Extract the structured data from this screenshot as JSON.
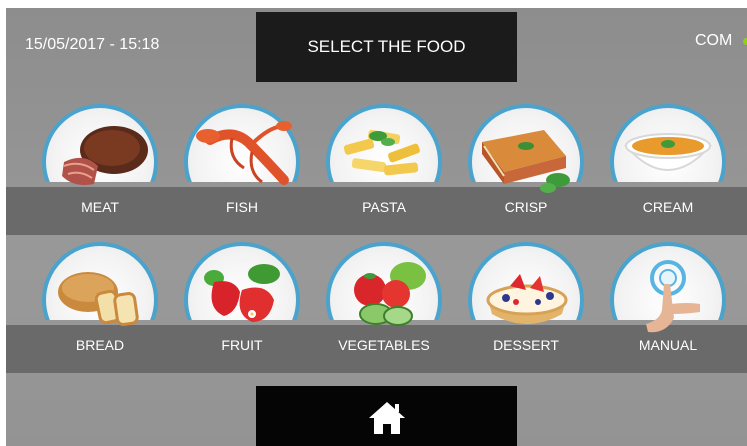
{
  "header": {
    "datetime": "15/05/2017 - 15:18",
    "title": "SELECT THE FOOD",
    "status_label": "COM",
    "status_color": "#8fd11a"
  },
  "foods_row1": [
    {
      "label": "MEAT",
      "icon": "meat-icon"
    },
    {
      "label": "FISH",
      "icon": "lobster-icon"
    },
    {
      "label": "PASTA",
      "icon": "pasta-icon"
    },
    {
      "label": "CRISP",
      "icon": "lasagna-icon"
    },
    {
      "label": "CREAM",
      "icon": "soup-bowl-icon"
    }
  ],
  "foods_row2": [
    {
      "label": "BREAD",
      "icon": "bread-icon"
    },
    {
      "label": "FRUIT",
      "icon": "strawberry-icon"
    },
    {
      "label": "VEGETABLES",
      "icon": "vegetables-icon"
    },
    {
      "label": "DESSERT",
      "icon": "fruit-tart-icon"
    },
    {
      "label": "MANUAL",
      "icon": "hand-touch-icon"
    }
  ],
  "footer": {
    "home_icon": "home-icon"
  },
  "colors": {
    "circle_ring": "#4aa3cc",
    "band": "#6a6a6a",
    "title_bg": "#1b1b1b"
  }
}
